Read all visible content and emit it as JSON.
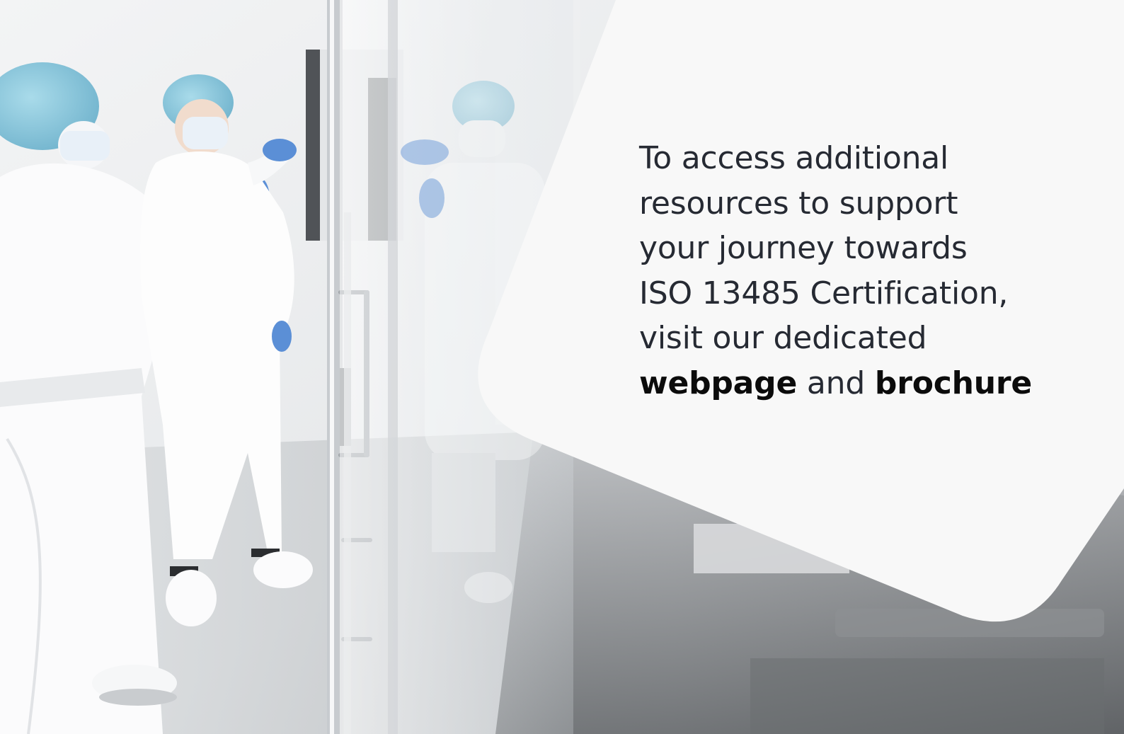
{
  "slide": {
    "lines": [
      "To access additional",
      "resources to support",
      "your journey towards",
      "ISO 13485 Certification,"
    ],
    "last_line": {
      "prefix": "visit our dedicated",
      "link1": "webpage",
      "conjunction": "and",
      "link2": "brochure"
    }
  },
  "photo": {
    "description_icon": "cleanroom-photo",
    "colors": {
      "panel": "#f8f8f8",
      "text": "#262a33",
      "link": "#0b0b0b",
      "glove": "#5b8fd6",
      "cap": "#7fc0da"
    }
  }
}
